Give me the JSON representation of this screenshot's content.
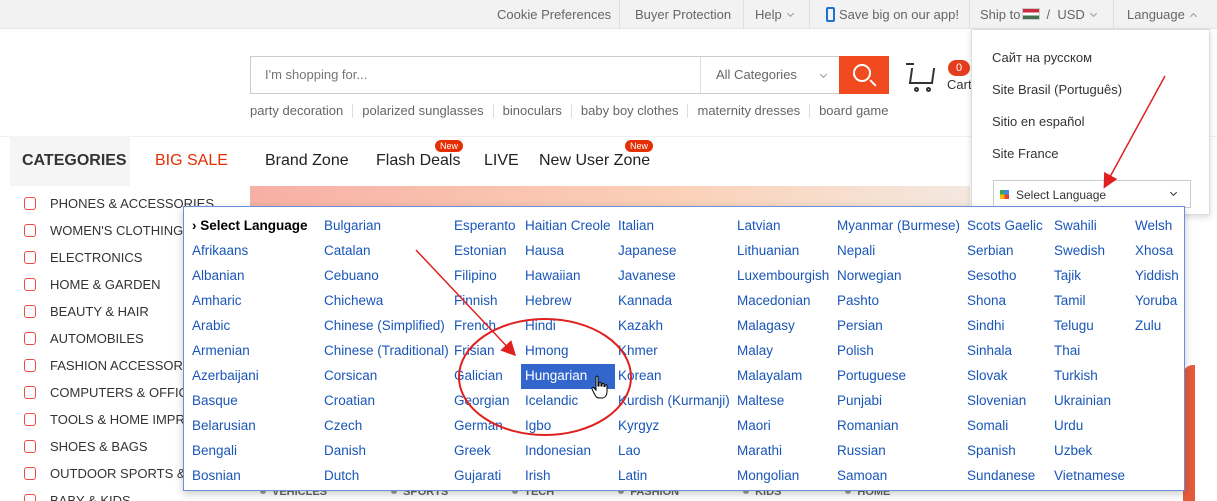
{
  "topbar": {
    "cookie": "Cookie Preferences",
    "buyer_protection": "Buyer Protection",
    "help": "Help",
    "app": "Save big on our app!",
    "ship_to": "Ship to",
    "currency": "USD",
    "language": "Language"
  },
  "search": {
    "placeholder": "I'm shopping for...",
    "category": "All Categories",
    "hot": [
      "party decoration",
      "polarized sunglasses",
      "binoculars",
      "baby boy clothes",
      "maternity dresses",
      "board game"
    ]
  },
  "cart": {
    "count": "0",
    "label": "Cart"
  },
  "nav": {
    "categories": "CATEGORIES",
    "big_sale": "BIG SALE",
    "links": [
      "Brand Zone",
      "Flash Deals",
      "LIVE",
      "New User Zone"
    ],
    "new_badge": "New"
  },
  "sidebar": [
    "PHONES & ACCESSORIES",
    "WOMEN'S CLOTHING",
    "ELECTRONICS",
    "HOME & GARDEN",
    "BEAUTY & HAIR",
    "AUTOMOBILES",
    "FASHION ACCESSORIES",
    "COMPUTERS & OFFICE",
    "TOOLS & HOME IMPROVEMENT",
    "SHOES & BAGS",
    "OUTDOOR SPORTS &",
    "BABY & KIDS"
  ],
  "bottom_tabs": [
    "VEHICLES",
    "SPORTS",
    "TECH",
    "FASHION",
    "KIDS",
    "HOME"
  ],
  "language_dropdown": {
    "options": [
      "Сайт на русском",
      "Site Brasil (Português)",
      "Sitio en español",
      "Site France"
    ],
    "select_label": "Select Language"
  },
  "translate_menu": {
    "columns": [
      [
        "› Select Language",
        "Afrikaans",
        "Albanian",
        "Amharic",
        "Arabic",
        "Armenian",
        "Azerbaijani",
        "Basque",
        "Belarusian",
        "Bengali",
        "Bosnian"
      ],
      [
        "Bulgarian",
        "Catalan",
        "Cebuano",
        "Chichewa",
        "Chinese (Simplified)",
        "Chinese (Traditional)",
        "Corsican",
        "Croatian",
        "Czech",
        "Danish",
        "Dutch"
      ],
      [
        "Esperanto",
        "Estonian",
        "Filipino",
        "Finnish",
        "French",
        "Frisian",
        "Galician",
        "Georgian",
        "German",
        "Greek",
        "Gujarati"
      ],
      [
        "Haitian Creole",
        "Hausa",
        "Hawaiian",
        "Hebrew",
        "Hindi",
        "Hmong",
        "Hungarian",
        "Icelandic",
        "Igbo",
        "Indonesian",
        "Irish"
      ],
      [
        "Italian",
        "Japanese",
        "Javanese",
        "Kannada",
        "Kazakh",
        "Khmer",
        "Korean",
        "Kurdish (Kurmanji)",
        "Kyrgyz",
        "Lao",
        "Latin"
      ],
      [
        "Latvian",
        "Lithuanian",
        "Luxembourgish",
        "Macedonian",
        "Malagasy",
        "Malay",
        "Malayalam",
        "Maltese",
        "Maori",
        "Marathi",
        "Mongolian"
      ],
      [
        "Myanmar (Burmese)",
        "Nepali",
        "Norwegian",
        "Pashto",
        "Persian",
        "Polish",
        "Portuguese",
        "Punjabi",
        "Romanian",
        "Russian",
        "Samoan"
      ],
      [
        "Scots Gaelic",
        "Serbian",
        "Sesotho",
        "Shona",
        "Sindhi",
        "Sinhala",
        "Slovak",
        "Slovenian",
        "Somali",
        "Spanish",
        "Sundanese"
      ],
      [
        "Swahili",
        "Swedish",
        "Tajik",
        "Tamil",
        "Telugu",
        "Thai",
        "Turkish",
        "Ukrainian",
        "Urdu",
        "Uzbek",
        "Vietnamese"
      ],
      [
        "Welsh",
        "Xhosa",
        "Yiddish",
        "Yoruba",
        "Zulu"
      ]
    ],
    "highlighted": "Hungarian"
  },
  "colors": {
    "accent": "#f04a1e",
    "link": "#1a56b8",
    "highlight": "#3366cc",
    "annotation": "#e02020"
  }
}
